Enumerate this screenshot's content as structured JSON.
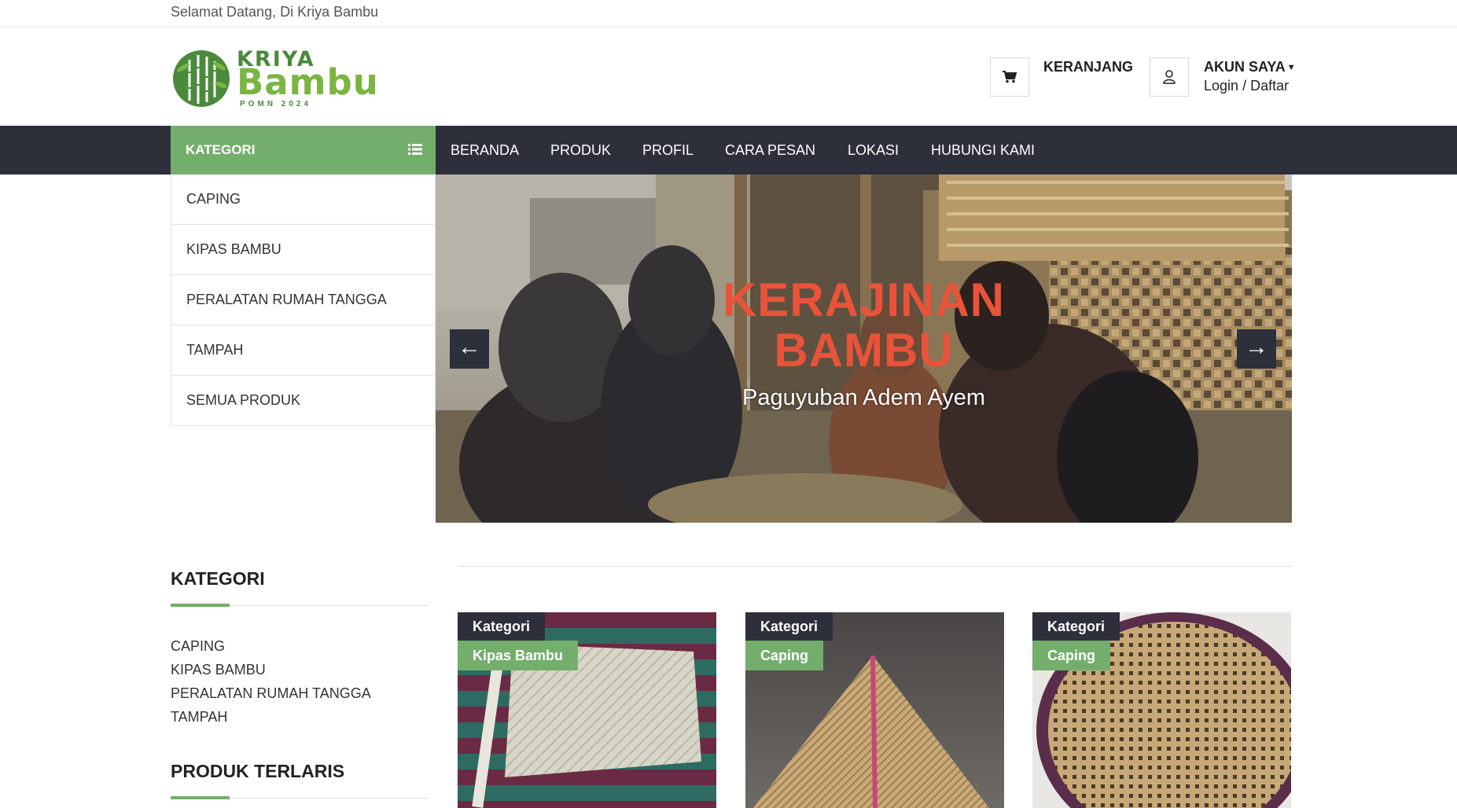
{
  "topbar": {
    "welcome": "Selamat Datang, Di Kriya Bambu"
  },
  "logo": {
    "line1": "KRIYA",
    "line2": "Bambu",
    "line3": "POMN 2024"
  },
  "header": {
    "cart_label": "KERANJANG",
    "account_label": "AKUN SAYA",
    "login_label": "Login",
    "separator": "/",
    "register_label": "Daftar"
  },
  "nav": {
    "category_toggle": "KATEGORI",
    "items": [
      "BERANDA",
      "PRODUK",
      "PROFIL",
      "CARA PESAN",
      "LOKASI",
      "HUBUNGI KAMI"
    ]
  },
  "category_menu": [
    "CAPING",
    "KIPAS BAMBU",
    "PERALATAN RUMAH TANGGA",
    "TAMPAH",
    "SEMUA PRODUK"
  ],
  "slider": {
    "title_line1": "KERAJINAN",
    "title_line2": "BAMBU",
    "subtitle": "Paguyuban Adem Ayem",
    "prev": "←",
    "next": "→"
  },
  "sidebar": {
    "category_heading": "KATEGORI",
    "categories": [
      "CAPING",
      "KIPAS BAMBU",
      "PERALATAN RUMAH TANGGA",
      "TAMPAH"
    ],
    "bestseller_heading": "PRODUK TERLARIS"
  },
  "products": [
    {
      "tag_label": "Kategori",
      "tag_value": "Kipas Bambu"
    },
    {
      "tag_label": "Kategori",
      "tag_value": "Caping"
    },
    {
      "tag_label": "Kategori",
      "tag_value": "Caping"
    }
  ],
  "colors": {
    "accent_green": "#74ae6c",
    "nav_dark": "#2d2f3b",
    "slide_title": "#e8533a",
    "logo_green": "#4a8a3c"
  },
  "icons": [
    "cart-icon",
    "user-icon",
    "list-icon",
    "arrow-left-icon",
    "arrow-right-icon",
    "bamboo-logo-icon"
  ]
}
